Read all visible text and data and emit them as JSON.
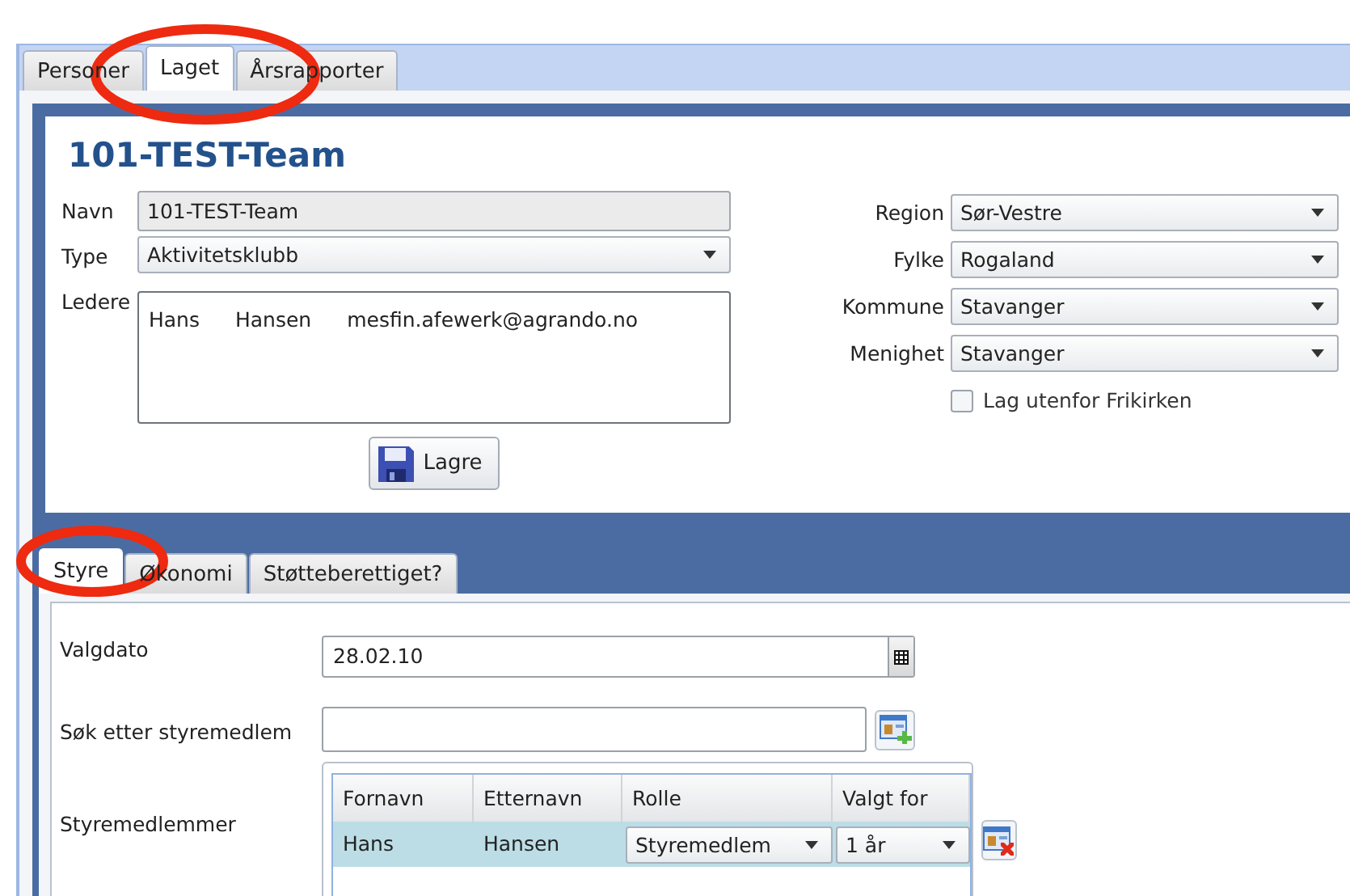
{
  "top_tabs": [
    {
      "label": "Personer",
      "selected": false
    },
    {
      "label": "Laget",
      "selected": true
    },
    {
      "label": "Årsrapporter",
      "selected": false
    }
  ],
  "team": {
    "title": "101-TEST-Team",
    "navn": {
      "label": "Navn",
      "value": "101-TEST-Team",
      "disabled": true
    },
    "type": {
      "label": "Type",
      "value": "Aktivitetsklubb"
    },
    "ledere": {
      "label": "Ledere",
      "rows": [
        [
          "Hans",
          "Hansen",
          "mesfin.afewerk@agrando.no"
        ]
      ]
    },
    "save_button": "Lagre",
    "location": [
      {
        "label": "Region",
        "value": "Sør-Vestre"
      },
      {
        "label": "Fylke",
        "value": "Rogaland"
      },
      {
        "label": "Kommune",
        "value": "Stavanger"
      },
      {
        "label": "Menighet",
        "value": "Stavanger"
      }
    ],
    "outside_checkbox": {
      "label": "Lag utenfor Frikirken",
      "checked": false
    }
  },
  "bottom_tabs": [
    {
      "label": "Styre",
      "selected": true
    },
    {
      "label": "Økonomi",
      "selected": false
    },
    {
      "label": "Støtteberettiget?",
      "selected": false
    }
  ],
  "styre": {
    "valgdato": {
      "label": "Valgdato",
      "value": "28.02.10"
    },
    "search": {
      "label": "Søk etter styremedlem"
    },
    "members_label": "Styremedlemmer",
    "columns": [
      "Fornavn",
      "Etternavn",
      "Rolle",
      "Valgt for"
    ],
    "rows": [
      {
        "fornavn": "Hans",
        "etternavn": "Hansen",
        "rolle": "Styremedlem",
        "valgt_for": "1 år",
        "selected": true
      }
    ]
  },
  "annotations": [
    {
      "kind": "ellipse"
    },
    {
      "kind": "ellipse"
    }
  ]
}
